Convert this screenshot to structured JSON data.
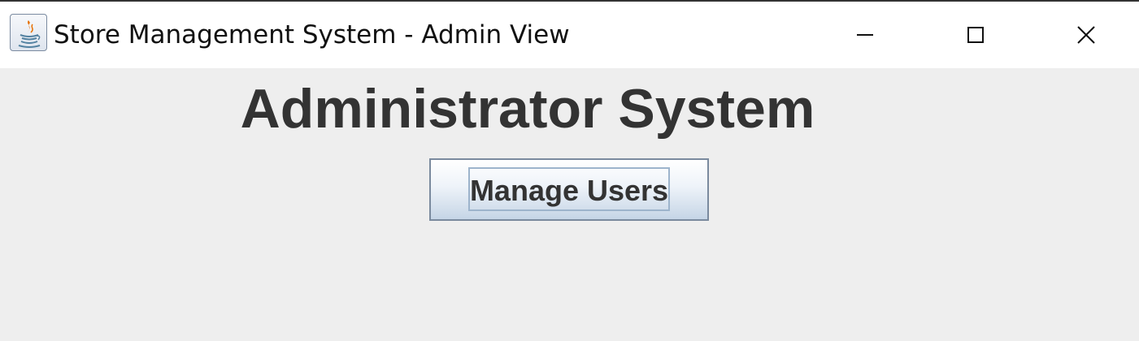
{
  "window": {
    "title": "Store Management System - Admin View",
    "app_icon": "java-coffee-cup-icon",
    "controls": {
      "minimize_icon": "minimize-icon",
      "maximize_icon": "maximize-icon",
      "close_icon": "close-icon"
    }
  },
  "main": {
    "heading": "Administrator System",
    "manage_users_label": "Manage Users"
  },
  "colors": {
    "background": "#eeeeee",
    "titlebar": "#ffffff",
    "text": "#333333",
    "button_border": "#7a8a9e",
    "focus_ring": "#9db4cc"
  }
}
